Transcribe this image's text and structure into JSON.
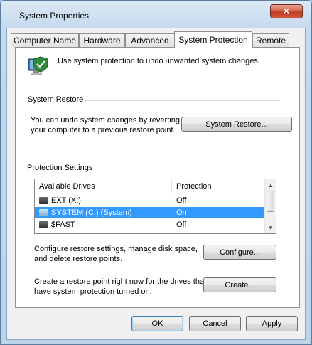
{
  "window": {
    "title": "System Properties",
    "close_glyph": "✕"
  },
  "tabs": [
    {
      "label": "Computer Name"
    },
    {
      "label": "Hardware"
    },
    {
      "label": "Advanced"
    },
    {
      "label": "System Protection"
    },
    {
      "label": "Remote"
    }
  ],
  "intro": {
    "text": "Use system protection to undo unwanted system changes.",
    "icon": "computer-shield-icon"
  },
  "system_restore": {
    "heading": "System Restore",
    "line1": "You can undo system changes by reverting",
    "line2": "your computer to a previous restore point.",
    "button": "System Restore..."
  },
  "protection": {
    "heading": "Protection Settings",
    "columns": [
      "Available Drives",
      "Protection"
    ],
    "drives": [
      {
        "name": "EXT (X:)",
        "protection": "Off",
        "icon": "hard-drive-icon"
      },
      {
        "name": "SYSTEM (C:) (System)",
        "protection": "On",
        "icon": "system-drive-icon",
        "selected": true
      },
      {
        "name": "$FAST",
        "protection": "Off",
        "icon": "hard-drive-icon"
      }
    ],
    "configure_line1": "Configure restore settings, manage disk space,",
    "configure_line2": "and delete restore points.",
    "configure_button": "Configure...",
    "create_line1": "Create a restore point right now for the drives that",
    "create_line2": "have system protection turned on.",
    "create_button": "Create..."
  },
  "footer": {
    "ok": "OK",
    "cancel": "Cancel",
    "apply": "Apply"
  },
  "colors": {
    "selection": "#3399ff",
    "close_button": "#c23d23"
  }
}
